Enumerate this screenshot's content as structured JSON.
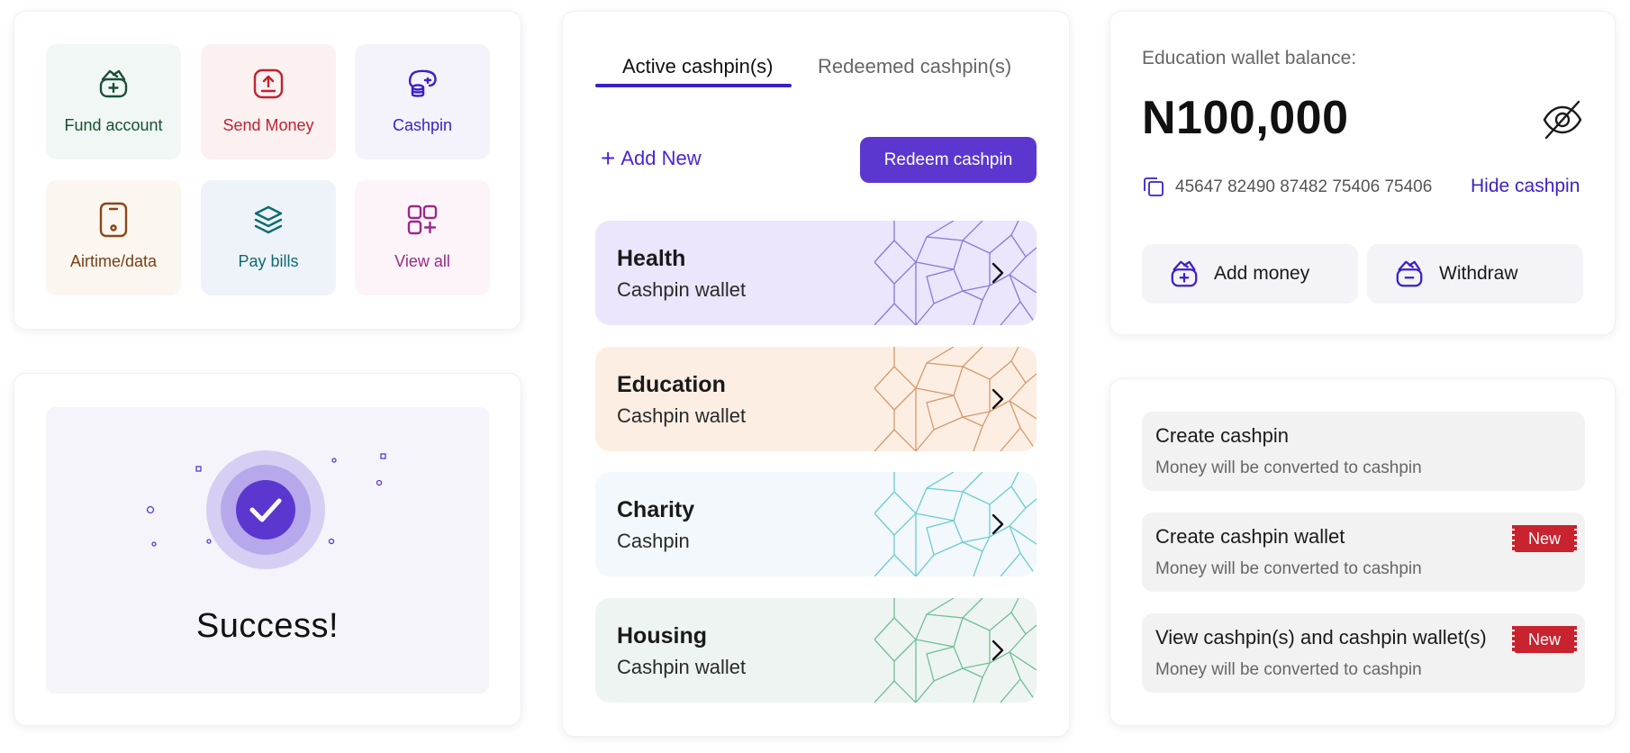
{
  "quick_actions": [
    {
      "label": "Fund account",
      "icon": "wallet-add-icon",
      "text_color": "#14532d",
      "bg": "#f1f7f4",
      "icon_color": "#1b4d3a"
    },
    {
      "label": "Send Money",
      "icon": "upload-box-icon",
      "text_color": "#c0232f",
      "bg": "#fbf1f1",
      "icon_color": "#c0232f"
    },
    {
      "label": "Cashpin",
      "icon": "coins-icon",
      "text_color": "#3d1fc7",
      "bg": "#f4f3fb",
      "icon_color": "#3d1fc7"
    },
    {
      "label": "Airtime/data",
      "icon": "phone-icon",
      "text_color": "#7a3e12",
      "bg": "#fcf6f0",
      "icon_color": "#8a4718"
    },
    {
      "label": "Pay bills",
      "icon": "layers-icon",
      "text_color": "#0d6b72",
      "bg": "#eef3f9",
      "icon_color": "#0d6b72"
    },
    {
      "label": "View all",
      "icon": "grid-plus-icon",
      "text_color": "#9a2a86",
      "bg": "#fcf4f9",
      "icon_color": "#9a2a86"
    }
  ],
  "success": {
    "title": "Success!"
  },
  "cashpins": {
    "tabs": [
      "Active cashpin(s)",
      "Redeemed cashpin(s)"
    ],
    "add_new_label": "Add New",
    "redeem_label": "Redeem cashpin",
    "wallets": [
      {
        "title": "Health",
        "subtitle": "Cashpin wallet",
        "bg": "#ebe6fb",
        "line": "#8a78d8"
      },
      {
        "title": "Education",
        "subtitle": "Cashpin wallet",
        "bg": "#fdeee3",
        "line": "#d39a6c"
      },
      {
        "title": "Charity",
        "subtitle": "Cashpin",
        "bg": "#f2f8fb",
        "line": "#6ccbd3"
      },
      {
        "title": "Housing",
        "subtitle": "Cashpin wallet",
        "bg": "#eef4f1",
        "line": "#6fbf97"
      }
    ]
  },
  "balance": {
    "label": "Education wallet balance:",
    "value": "N100,000",
    "pin": "45647 82490 87482 75406 75406",
    "hide_label": "Hide cashpin",
    "add_money_label": "Add money",
    "withdraw_label": "Withdraw"
  },
  "options": [
    {
      "title": "Create cashpin",
      "subtitle": "Money will be converted to cashpin",
      "badge": ""
    },
    {
      "title": "Create cashpin wallet",
      "subtitle": "Money will be converted to cashpin",
      "badge": "New"
    },
    {
      "title": "View cashpin(s) and cashpin wallet(s)",
      "subtitle": "Money will be converted to cashpin",
      "badge": "New"
    }
  ],
  "colors": {
    "accent": "#5b37d0",
    "accent_dark": "#3d1fc7",
    "badge": "#c8232f"
  }
}
